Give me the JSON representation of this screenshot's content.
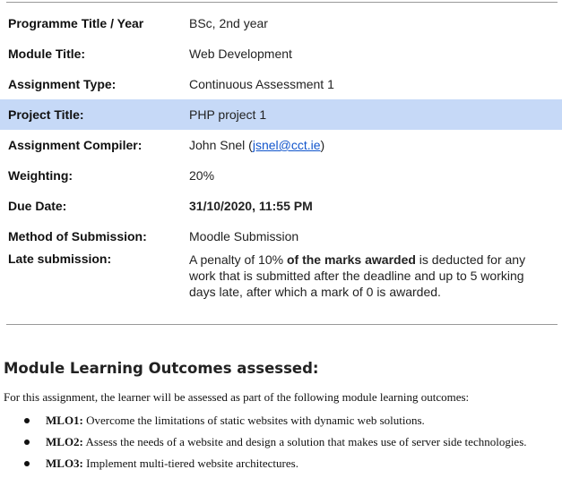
{
  "rows": [
    {
      "label": "Programme Title / Year",
      "value": "BSc, 2nd year"
    },
    {
      "label": "Module Title:",
      "value": "Web Development"
    },
    {
      "label": "Assignment Type:",
      "value": "Continuous Assessment 1"
    },
    {
      "label": "Project Title:",
      "value": "PHP project 1"
    },
    {
      "label": "Assignment Compiler:",
      "name": "John Snel",
      "email": "jsnel@cct.ie"
    },
    {
      "label": "Weighting:",
      "value": "20%"
    },
    {
      "label": "Due Date:",
      "value": "31/10/2020, 11:55 PM"
    },
    {
      "label": "Method of Submission:",
      "value": "Moodle Submission"
    },
    {
      "label": "Late submission:",
      "value_pre": "A penalty of 10% ",
      "value_bold": "of the marks awarded",
      "value_post": " is deducted for any work that is submitted after the deadline and up to 5 working days late, after which a mark of 0 is awarded."
    }
  ],
  "highlight_color": "#c6d9f7",
  "link_color": "#1155cc",
  "section": {
    "title": "Module Learning Outcomes assessed:",
    "intro": "For this assignment, the learner will be assessed as part of the following module learning outcomes:",
    "outcomes": [
      {
        "code": "MLO1:",
        "text": "Overcome the limitations of static websites with dynamic web solutions."
      },
      {
        "code": "MLO2:",
        "text": "Assess the needs of a website and design a solution that makes use of server side technologies."
      },
      {
        "code": "MLO3:",
        "text": "Implement multi-tiered website architectures."
      }
    ]
  }
}
